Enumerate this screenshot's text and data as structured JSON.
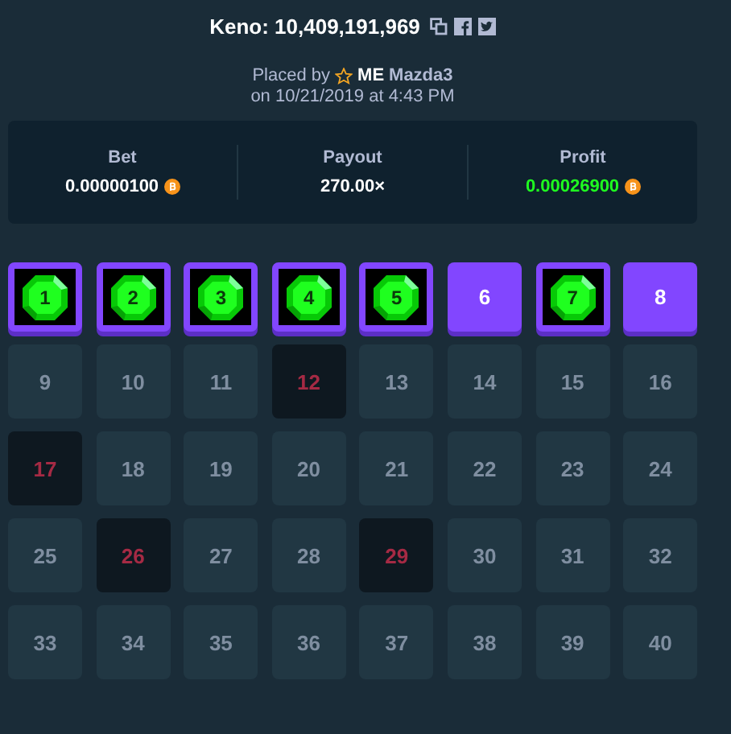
{
  "title": "Keno: 10,409,191,969",
  "placed": {
    "prefix": "Placed by",
    "rank": "ME",
    "user": "Mazda3",
    "date": "on 10/21/2019 at 4:43 PM"
  },
  "stats": [
    {
      "label": "Bet",
      "value": "0.00000100",
      "coin": true,
      "kind": "plain"
    },
    {
      "label": "Payout",
      "value": "270.00×",
      "coin": false,
      "kind": "plain"
    },
    {
      "label": "Profit",
      "value": "0.00026900",
      "coin": true,
      "kind": "profit"
    }
  ],
  "tiles": [
    {
      "number": "1",
      "kind": "hit"
    },
    {
      "number": "2",
      "kind": "hit"
    },
    {
      "number": "3",
      "kind": "hit"
    },
    {
      "number": "4",
      "kind": "hit"
    },
    {
      "number": "5",
      "kind": "hit"
    },
    {
      "number": "6",
      "kind": "picked"
    },
    {
      "number": "7",
      "kind": "hit"
    },
    {
      "number": "8",
      "kind": "picked"
    },
    {
      "number": "9",
      "kind": "plain"
    },
    {
      "number": "10",
      "kind": "plain"
    },
    {
      "number": "11",
      "kind": "plain"
    },
    {
      "number": "12",
      "kind": "drawn"
    },
    {
      "number": "13",
      "kind": "plain"
    },
    {
      "number": "14",
      "kind": "plain"
    },
    {
      "number": "15",
      "kind": "plain"
    },
    {
      "number": "16",
      "kind": "plain"
    },
    {
      "number": "17",
      "kind": "drawn"
    },
    {
      "number": "18",
      "kind": "plain"
    },
    {
      "number": "19",
      "kind": "plain"
    },
    {
      "number": "20",
      "kind": "plain"
    },
    {
      "number": "21",
      "kind": "plain"
    },
    {
      "number": "22",
      "kind": "plain"
    },
    {
      "number": "23",
      "kind": "plain"
    },
    {
      "number": "24",
      "kind": "plain"
    },
    {
      "number": "25",
      "kind": "plain"
    },
    {
      "number": "26",
      "kind": "drawn"
    },
    {
      "number": "27",
      "kind": "plain"
    },
    {
      "number": "28",
      "kind": "plain"
    },
    {
      "number": "29",
      "kind": "drawn"
    },
    {
      "number": "30",
      "kind": "plain"
    },
    {
      "number": "31",
      "kind": "plain"
    },
    {
      "number": "32",
      "kind": "plain"
    },
    {
      "number": "33",
      "kind": "plain"
    },
    {
      "number": "34",
      "kind": "plain"
    },
    {
      "number": "35",
      "kind": "plain"
    },
    {
      "number": "36",
      "kind": "plain"
    },
    {
      "number": "37",
      "kind": "plain"
    },
    {
      "number": "38",
      "kind": "plain"
    },
    {
      "number": "39",
      "kind": "plain"
    },
    {
      "number": "40",
      "kind": "plain"
    }
  ]
}
